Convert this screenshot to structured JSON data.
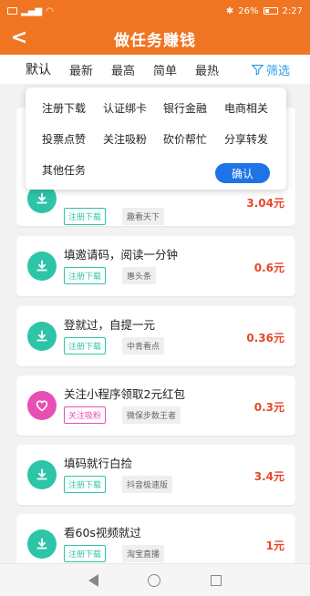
{
  "status": {
    "left_icons": "sim · signal · wifi",
    "battery_percent": "26%",
    "time": "2:27"
  },
  "header": {
    "back_icon": "chevron-left-icon",
    "title": "做任务赚钱"
  },
  "sort_tabs": [
    "默认",
    "最新",
    "最高",
    "简单",
    "最热"
  ],
  "filter": {
    "label": "筛选",
    "icon": "filter-icon",
    "color": "#2b9be8"
  },
  "dropdown": {
    "options": [
      "注册下载",
      "认证绑卡",
      "银行金融",
      "电商相关",
      "投票点赞",
      "关注吸粉",
      "砍价帮忙",
      "分享转发",
      "其他任务"
    ],
    "confirm_label": "确认"
  },
  "tasks": [
    {
      "title": "",
      "tag": "注册下载",
      "tag_color": "#2ec4a7",
      "source": "趣看天下",
      "price": "3.04元",
      "icon": "download-icon"
    },
    {
      "title": "填邀请码，阅读一分钟",
      "tag": "注册下载",
      "tag_color": "#2ec4a7",
      "source": "惠头条",
      "price": "0.6元",
      "icon": "download-icon"
    },
    {
      "title": "登就过，自提一元",
      "tag": "注册下载",
      "tag_color": "#2ec4a7",
      "source": "中青看点",
      "price": "0.36元",
      "icon": "download-icon"
    },
    {
      "title": "关注小程序领取2元红包",
      "tag": "关注吸粉",
      "tag_color": "#e84fb5",
      "source": "微保步数王者",
      "price": "0.3元",
      "icon": "heart-icon"
    },
    {
      "title": "填码就行白捡",
      "tag": "注册下载",
      "tag_color": "#2ec4a7",
      "source": "抖音极速版",
      "price": "3.4元",
      "icon": "download-icon"
    },
    {
      "title": "看60s视频就过",
      "tag": "注册下载",
      "tag_color": "#2ec4a7",
      "source": "淘宝直播",
      "price": "1元",
      "icon": "download-icon"
    }
  ],
  "colors": {
    "brand": "#f07522",
    "price": "#e8462a",
    "confirm": "#1e73e6"
  }
}
